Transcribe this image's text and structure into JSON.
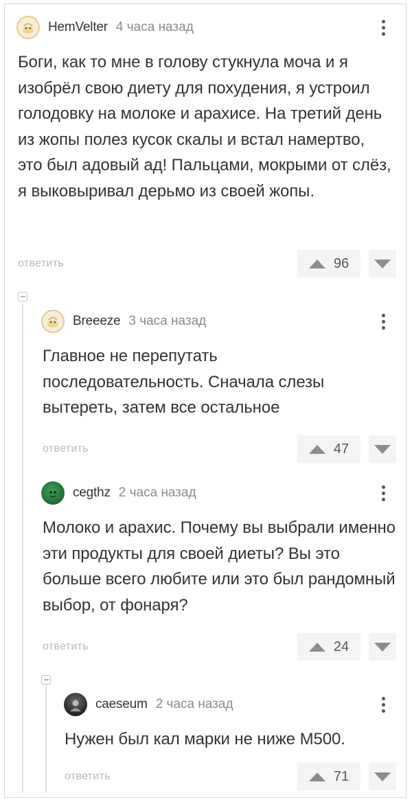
{
  "comments": [
    {
      "username": "HemVelter",
      "time": "4 часа назад",
      "text": "Боги, как то мне в голову стукнула моча и я изобрёл свою диету для похудения, я устроил голодовку на молоке и арахисе. На третий день из жопы полез кусок скалы и встал намертво, это был адовый ад! Пальцами, мокрыми от слёз, я выковыривал дерьмо из своей жопы.",
      "reply": "ответить",
      "votes": "96",
      "avatar": "default-avatar-icon"
    },
    {
      "username": "Breeeze",
      "time": "3 часа назад",
      "text": "Главное не перепутать последовательность. Сначала слезы вытереть, затем все остальное",
      "reply": "ответить",
      "votes": "47",
      "avatar": "default-avatar-icon"
    },
    {
      "username": "cegthz",
      "time": "2 часа назад",
      "text": "Молоко и арахис. Почему вы выбрали именно эти продукты для своей диеты? Вы это больше всего любите или это был рандомный выбор, от фонаря?",
      "reply": "ответить",
      "votes": "24",
      "avatar": "green-avatar-icon"
    },
    {
      "username": "caeseum",
      "time": "2 часа назад",
      "text": "Нужен был кал марки не ниже М500.",
      "reply": "ответить",
      "votes": "71",
      "avatar": "dark-avatar-icon"
    }
  ],
  "colors": {
    "text": "#333333",
    "muted": "#8a8a8a",
    "reply": "#b8b8b8",
    "vote_bg": "#f4f4f4",
    "thread_line": "#e2e2e2"
  }
}
